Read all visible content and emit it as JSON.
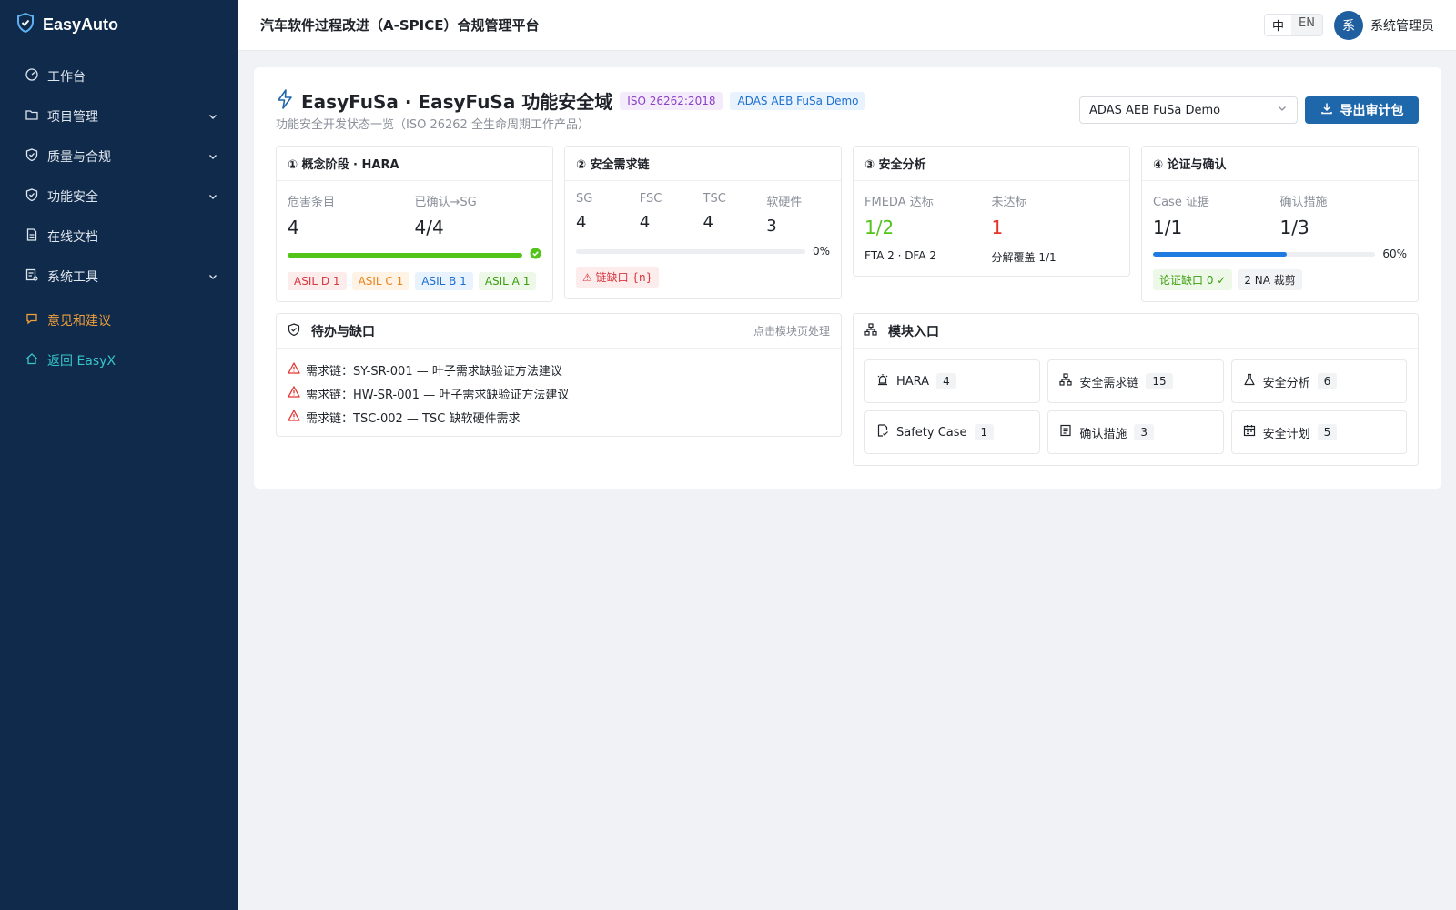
{
  "brand": {
    "name": "EasyAuto"
  },
  "sidebar": {
    "items": [
      {
        "label": "工作台",
        "icon": "dashboard-icon",
        "expandable": false
      },
      {
        "label": "项目管理",
        "icon": "folder-icon",
        "expandable": true
      },
      {
        "label": "质量与合规",
        "icon": "shield-icon",
        "expandable": true
      },
      {
        "label": "功能安全",
        "icon": "shield-check-icon",
        "expandable": true
      },
      {
        "label": "在线文档",
        "icon": "document-icon",
        "expandable": false
      },
      {
        "label": "系统工具",
        "icon": "tool-icon",
        "expandable": true
      }
    ],
    "feedback": "意见和建议",
    "back": "返回 EasyX"
  },
  "header": {
    "title": "汽车软件过程改进（A-SPICE）合规管理平台",
    "lang_zh": "中",
    "lang_en": "EN",
    "avatar_text": "系",
    "user_name": "系统管理员"
  },
  "page": {
    "title": "EasyFuSa · EasyFuSa 功能安全域",
    "tag_standard": "ISO 26262:2018",
    "tag_project": "ADAS AEB FuSa Demo",
    "subtitle": "功能安全开发状态一览（ISO 26262 全生命周期工作产品）",
    "project_select": "ADAS AEB FuSa Demo",
    "export_label": "导出审计包"
  },
  "stages": {
    "hara": {
      "title": "① 概念阶段 · HARA",
      "m1_label": "危害条目",
      "m1_value": "4",
      "m2_label": "已确认→SG",
      "m2_value": "4/4",
      "progress": 1.0,
      "chips": [
        "ASIL D 1",
        "ASIL C 1",
        "ASIL B 1",
        "ASIL A 1"
      ]
    },
    "req": {
      "title": "② 安全需求链",
      "labels": [
        "SG",
        "FSC",
        "TSC",
        "软硬件"
      ],
      "values": [
        "4",
        "4",
        "4",
        "3"
      ],
      "progress": 0,
      "progress_text": "0%",
      "chip": "⚠ 链缺口 {n}"
    },
    "analysis": {
      "title": "③ 安全分析",
      "m1_label": "FMEDA 达标",
      "m1_value": "1/2",
      "m2_label": "未达标",
      "m2_value": "1",
      "sub1": "FTA 2 · DFA 2",
      "sub2": "分解覆盖 1/1"
    },
    "argument": {
      "title": "④ 论证与确认",
      "m1_label": "Case 证据",
      "m1_value": "1/1",
      "m2_label": "确认措施",
      "m2_value": "1/3",
      "progress": 0.6,
      "progress_text": "60%",
      "chip1": "论证缺口 0 ✓",
      "chip2": "2 NA 裁剪"
    }
  },
  "todo": {
    "title": "待办与缺口",
    "hint": "点击模块页处理",
    "items": [
      "需求链：SY-SR-001 — 叶子需求缺验证方法建议",
      "需求链：HW-SR-001 — 叶子需求缺验证方法建议",
      "需求链：TSC-002 — TSC 缺软硬件需求"
    ]
  },
  "modules": {
    "title": "模块入口",
    "items": [
      {
        "label": "HARA",
        "count": "4",
        "icon": "alarm-icon"
      },
      {
        "label": "安全需求链",
        "count": "15",
        "icon": "hierarchy-icon"
      },
      {
        "label": "安全分析",
        "count": "6",
        "icon": "flask-icon"
      },
      {
        "label": "Safety Case",
        "count": "1",
        "icon": "file-check-icon"
      },
      {
        "label": "确认措施",
        "count": "3",
        "icon": "checklist-icon"
      },
      {
        "label": "安全计划",
        "count": "5",
        "icon": "calendar-icon"
      }
    ]
  },
  "colors": {
    "sidebar_bg": "#0f2a4a",
    "primary": "#1f67ab",
    "success": "#52c41a",
    "danger": "#e5322d",
    "progress_blue": "#1e7be0",
    "feedback": "#f0a03c",
    "back": "#36c6c9"
  }
}
